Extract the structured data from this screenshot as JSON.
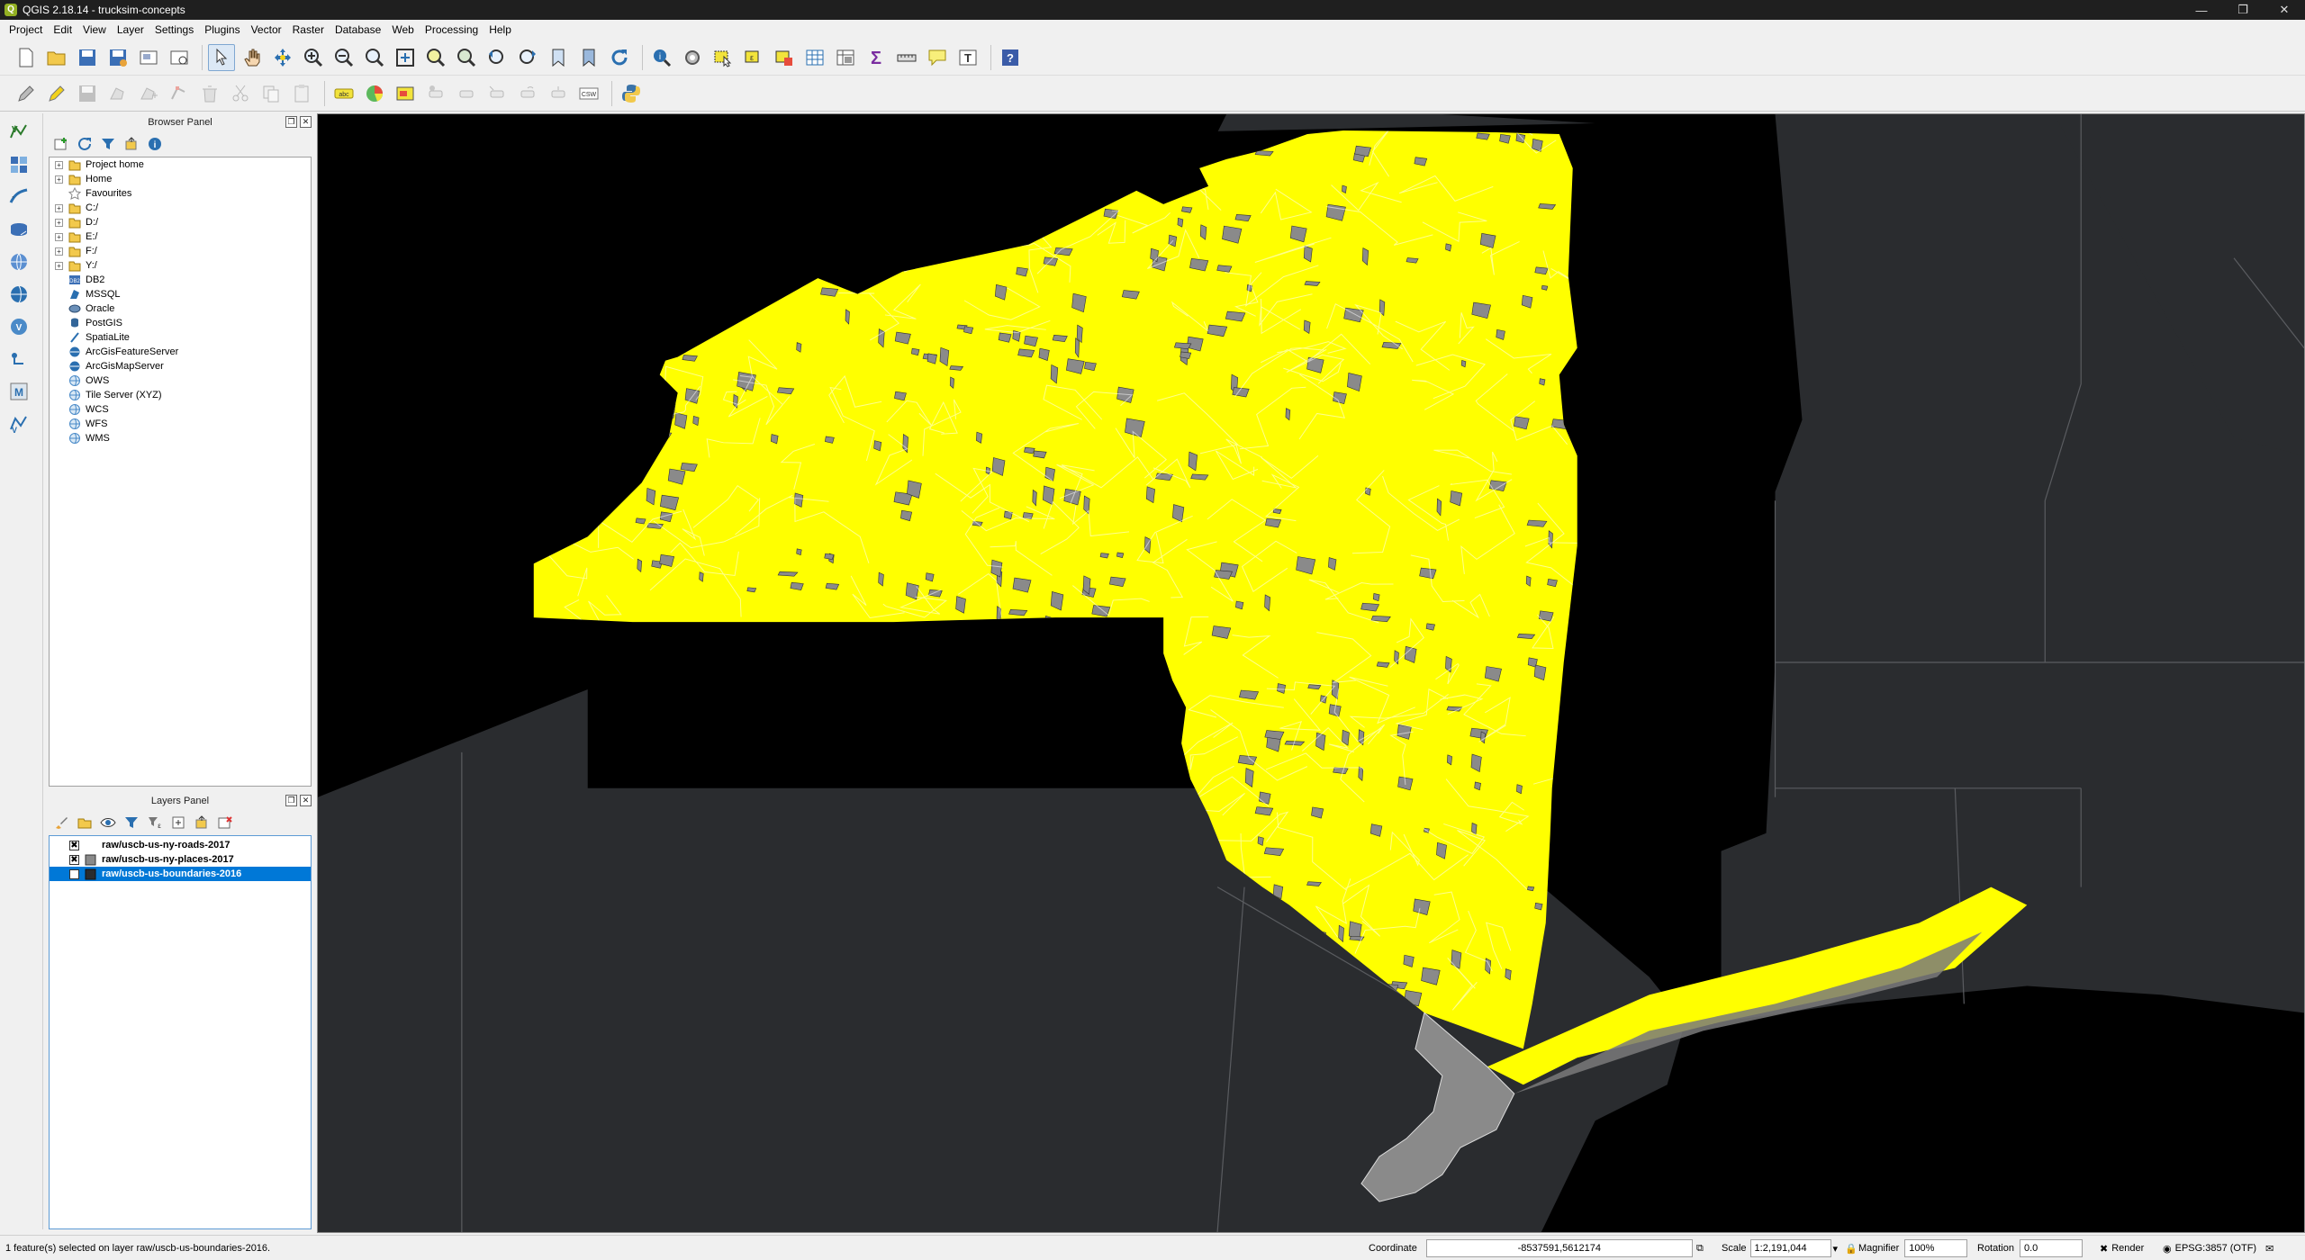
{
  "window": {
    "title": "QGIS 2.18.14 - trucksim-concepts",
    "controls": [
      "—",
      "❐",
      "✕"
    ]
  },
  "menubar": [
    "Project",
    "Edit",
    "View",
    "Layer",
    "Settings",
    "Plugins",
    "Vector",
    "Raster",
    "Database",
    "Web",
    "Processing",
    "Help"
  ],
  "toolbar": {
    "csw_label": "CSW",
    "abc_label": "abc"
  },
  "browser_panel": {
    "title": "Browser Panel",
    "items": [
      {
        "label": "Project home",
        "icon": "folder-icon",
        "expandable": true
      },
      {
        "label": "Home",
        "icon": "folder-icon",
        "expandable": true
      },
      {
        "label": "Favourites",
        "icon": "star-icon",
        "expandable": false
      },
      {
        "label": "C:/",
        "icon": "folder-icon",
        "expandable": true
      },
      {
        "label": "D:/",
        "icon": "folder-icon",
        "expandable": true
      },
      {
        "label": "E:/",
        "icon": "folder-icon",
        "expandable": true
      },
      {
        "label": "F:/",
        "icon": "folder-icon",
        "expandable": true
      },
      {
        "label": "Y:/",
        "icon": "folder-icon",
        "expandable": true
      },
      {
        "label": "DB2",
        "icon": "db2-icon",
        "expandable": false
      },
      {
        "label": "MSSQL",
        "icon": "mssql-icon",
        "expandable": false
      },
      {
        "label": "Oracle",
        "icon": "oracle-icon",
        "expandable": false
      },
      {
        "label": "PostGIS",
        "icon": "postgis-icon",
        "expandable": false
      },
      {
        "label": "SpatiaLite",
        "icon": "spatialite-icon",
        "expandable": false
      },
      {
        "label": "ArcGisFeatureServer",
        "icon": "arcgis-icon",
        "expandable": false
      },
      {
        "label": "ArcGisMapServer",
        "icon": "arcgis-icon",
        "expandable": false
      },
      {
        "label": "OWS",
        "icon": "globe-icon",
        "expandable": false
      },
      {
        "label": "Tile Server (XYZ)",
        "icon": "globe-icon",
        "expandable": false
      },
      {
        "label": "WCS",
        "icon": "globe-icon",
        "expandable": false
      },
      {
        "label": "WFS",
        "icon": "globe-icon",
        "expandable": false
      },
      {
        "label": "WMS",
        "icon": "globe-icon",
        "expandable": false
      }
    ]
  },
  "layers_panel": {
    "title": "Layers Panel",
    "layers": [
      {
        "name": "raw/uscb-us-ny-roads-2017",
        "checked": "✖",
        "symbol": "line",
        "selected": false
      },
      {
        "name": "raw/uscb-us-ny-places-2017",
        "checked": "✖",
        "symbol": "fill-gray",
        "selected": false
      },
      {
        "name": "raw/uscb-us-boundaries-2016",
        "checked": "✖",
        "symbol": "fill-dark",
        "selected": true
      }
    ]
  },
  "colors": {
    "map_background": "#000000",
    "states_fill": "#2a2c2f",
    "ny_fill": "#ffff00",
    "places_fill": "#8a8a8a",
    "roads": "#ffffff",
    "selection": "#0078d7"
  },
  "status": {
    "message": "1 feature(s) selected on layer raw/uscb-us-boundaries-2016.",
    "coordinate_label": "Coordinate",
    "coordinate_value": "-8537591,5612174",
    "scale_label": "Scale",
    "scale_value": "1:2,191,044",
    "magnifier_label": "Magnifier",
    "magnifier_value": "100%",
    "rotation_label": "Rotation",
    "rotation_value": "0.0",
    "render_label": "Render",
    "crs_label": "EPSG:3857 (OTF)"
  }
}
